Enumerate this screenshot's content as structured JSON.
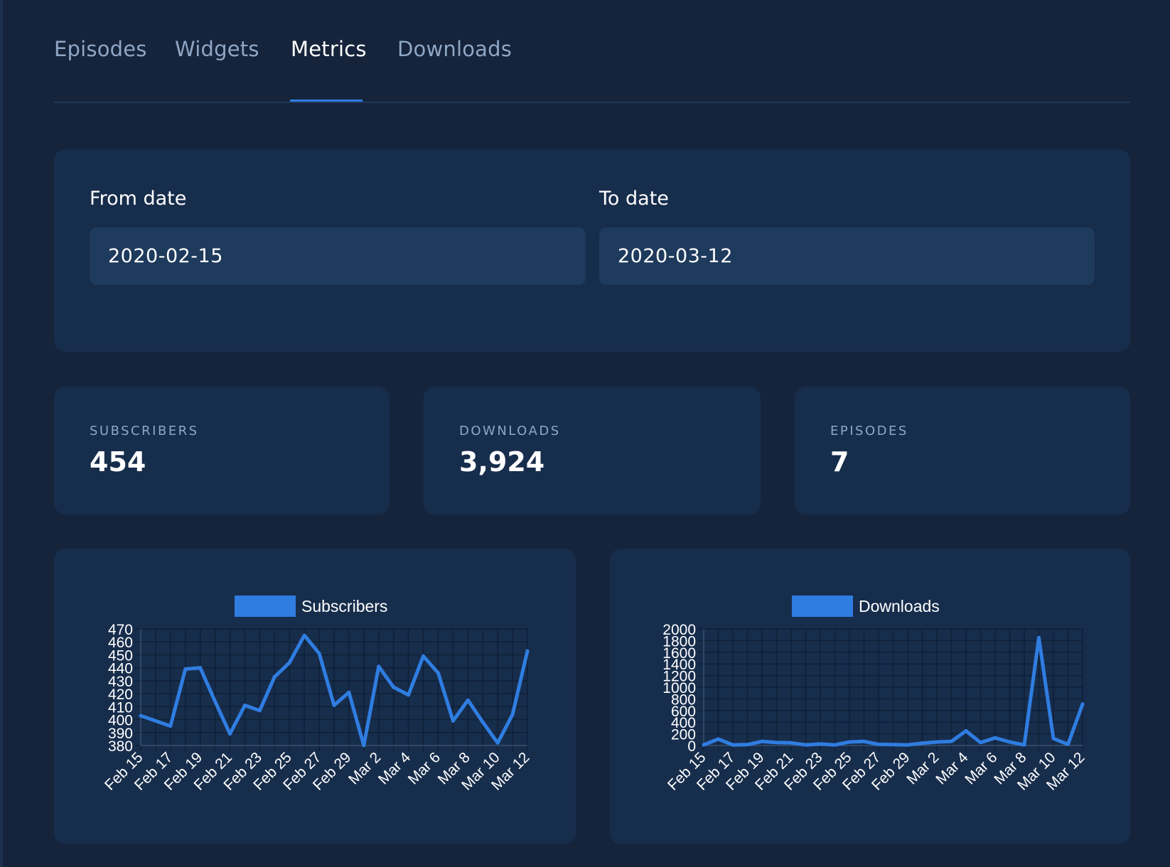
{
  "tabs": [
    {
      "label": "Episodes"
    },
    {
      "label": "Widgets"
    },
    {
      "label": "Metrics",
      "active": true
    },
    {
      "label": "Downloads"
    }
  ],
  "date_range": {
    "from_label": "From date",
    "from_value": "2020-02-15",
    "to_label": "To date",
    "to_value": "2020-03-12"
  },
  "stats": [
    {
      "label": "SUBSCRIBERS",
      "value": "454"
    },
    {
      "label": "DOWNLOADS",
      "value": "3,924"
    },
    {
      "label": "EPISODES",
      "value": "7"
    }
  ],
  "colors": {
    "background": "#15243b",
    "panel": "#172d4c",
    "input": "#1e3a5c",
    "accent": "#2f7de1",
    "muted_text": "#8fa6c4",
    "grid": "#0f2036"
  },
  "chart_data": [
    {
      "type": "line",
      "legend": "Subscribers",
      "legend_position": "top",
      "grid": true,
      "x": [
        "Feb 15",
        "Feb 16",
        "Feb 17",
        "Feb 18",
        "Feb 19",
        "Feb 20",
        "Feb 21",
        "Feb 22",
        "Feb 23",
        "Feb 24",
        "Feb 25",
        "Feb 26",
        "Feb 27",
        "Feb 28",
        "Feb 29",
        "Mar 1",
        "Mar 2",
        "Mar 3",
        "Mar 4",
        "Mar 5",
        "Mar 6",
        "Mar 7",
        "Mar 8",
        "Mar 9",
        "Mar 10",
        "Mar 11",
        "Mar 12"
      ],
      "x_tick_labels": [
        "Feb 15",
        "Feb 17",
        "Feb 19",
        "Feb 21",
        "Feb 23",
        "Feb 25",
        "Feb 27",
        "Feb 29",
        "Mar 2",
        "Mar 4",
        "Mar 6",
        "Mar 8",
        "Mar 10",
        "Mar 12"
      ],
      "series": [
        {
          "name": "Subscribers",
          "values": [
            403,
            399,
            395,
            439,
            440,
            414,
            389,
            411,
            407,
            433,
            444,
            465,
            451,
            411,
            421,
            380,
            441,
            425,
            419,
            449,
            436,
            399,
            415,
            398,
            382,
            404,
            453
          ]
        }
      ],
      "ylim": [
        380,
        470
      ],
      "y_ticks": [
        380,
        390,
        400,
        410,
        420,
        430,
        440,
        450,
        460,
        470
      ]
    },
    {
      "type": "line",
      "legend": "Downloads",
      "legend_position": "top",
      "grid": true,
      "x": [
        "Feb 15",
        "Feb 16",
        "Feb 17",
        "Feb 18",
        "Feb 19",
        "Feb 20",
        "Feb 21",
        "Feb 22",
        "Feb 23",
        "Feb 24",
        "Feb 25",
        "Feb 26",
        "Feb 27",
        "Feb 28",
        "Feb 29",
        "Mar 1",
        "Mar 2",
        "Mar 3",
        "Mar 4",
        "Mar 5",
        "Mar 6",
        "Mar 7",
        "Mar 8",
        "Mar 9",
        "Mar 10",
        "Mar 11",
        "Mar 12"
      ],
      "x_tick_labels": [
        "Feb 15",
        "Feb 17",
        "Feb 19",
        "Feb 21",
        "Feb 23",
        "Feb 25",
        "Feb 27",
        "Feb 29",
        "Mar 2",
        "Mar 4",
        "Mar 6",
        "Mar 8",
        "Mar 10",
        "Mar 12"
      ],
      "series": [
        {
          "name": "Downloads",
          "values": [
            10,
            110,
            10,
            15,
            70,
            50,
            45,
            10,
            25,
            10,
            60,
            70,
            20,
            15,
            10,
            40,
            60,
            70,
            250,
            50,
            130,
            60,
            10,
            1850,
            120,
            20,
            710
          ]
        }
      ],
      "ylim": [
        0,
        2000
      ],
      "y_ticks": [
        0,
        200,
        400,
        600,
        800,
        1000,
        1200,
        1400,
        1600,
        1800,
        2000
      ]
    }
  ]
}
